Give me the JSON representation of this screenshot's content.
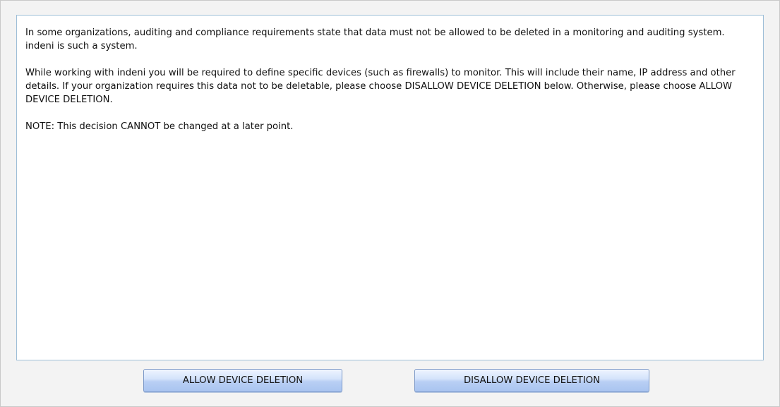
{
  "message": {
    "paragraphs": [
      "In some organizations, auditing and compliance requirements state that data must not be allowed to be deleted in a monitoring and auditing system. indeni is such a system.",
      "While working with indeni you will be required to define specific devices (such as firewalls) to monitor. This will include their name, IP address and other details. If your organization requires this data not to be deletable, please choose DISALLOW DEVICE DELETION below. Otherwise, please choose ALLOW DEVICE DELETION.",
      "NOTE: This decision CANNOT be changed at a later point."
    ]
  },
  "actions": {
    "allow_label": "ALLOW DEVICE DELETION",
    "disallow_label": "DISALLOW DEVICE DELETION"
  }
}
